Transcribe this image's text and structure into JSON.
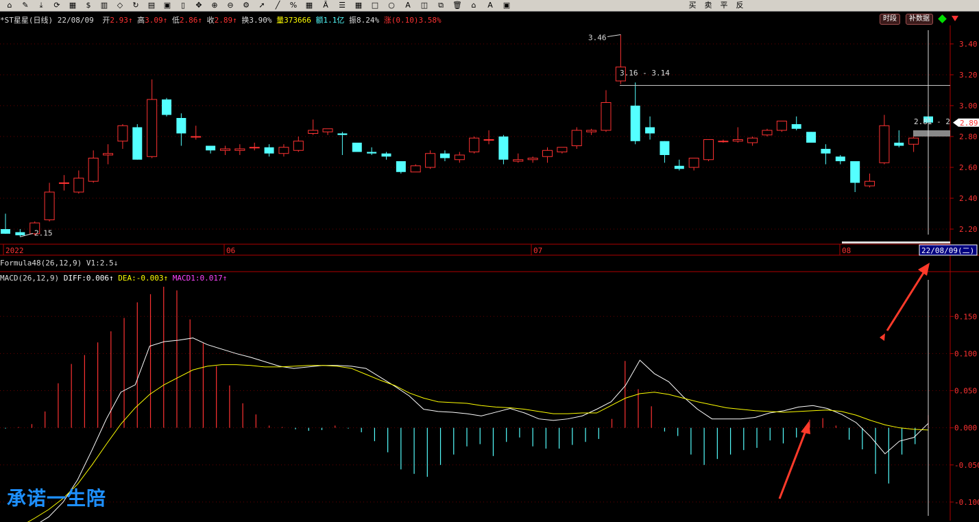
{
  "toolbar": {
    "icons": [
      "home-icon",
      "draw-icon",
      "download-icon",
      "sync-icon",
      "grid-icon",
      "dollar-icon",
      "bar-chart-icon",
      "diamond-icon",
      "refresh-icon",
      "doc-icon",
      "layout-icon",
      "book-icon",
      "move-icon",
      "zoom-in-icon",
      "zoom-out-icon",
      "settings-icon",
      "cursor-icon",
      "line-tool-icon",
      "percent-icon",
      "chart-type-icon",
      "text-tool-icon",
      "list-icon",
      "table-icon",
      "rect-tool-icon",
      "circle-tool-icon",
      "letter-a-icon",
      "shield-icon",
      "copy-icon",
      "trash-icon",
      "lock-icon",
      "font-color-icon",
      "save-icon"
    ],
    "text_buttons": [
      "买",
      "卖",
      "平",
      "反"
    ]
  },
  "header": {
    "title": "*ST星星(日线) 22/08/09",
    "open_label": "开",
    "open": "2.93",
    "high_label": "高",
    "high": "3.09",
    "low_label": "低",
    "low": "2.86",
    "close_label": "收",
    "close": "2.89",
    "turnover_label": "换",
    "turnover": "3.90%",
    "volume_label": "量",
    "volume": "373666",
    "amount_label": "额",
    "amount": "1.1亿",
    "amplitude_label": "振",
    "amplitude": "8.24%",
    "change_label": "涨",
    "change": "(0.10)3.58%",
    "btn_time": "时段",
    "btn_data": "补数据"
  },
  "formula_bar": {
    "text": "Formula48(26,12,9)  V1:2.5"
  },
  "macd_header": {
    "name": "MACD(26,12,9)",
    "diff_label": "DIFF:",
    "diff": "0.006",
    "dea_label": "DEA:",
    "dea": "-0.003",
    "macd_label": "MACD1:",
    "macd": "0.017"
  },
  "watermark": "承诺一生陪",
  "colors": {
    "up": "#ff3232",
    "down": "#54ffff",
    "axis": "#b00000",
    "diff": "#ffffff",
    "dea": "#ffff00",
    "bg": "#000000"
  },
  "chart_data": [
    {
      "type": "candlestick",
      "y_ticks": [
        "3.40",
        "3.20",
        "3.00",
        "2.80",
        "2.60",
        "2.40",
        "2.20"
      ],
      "ylim": [
        2.12,
        3.52
      ],
      "x_labels": [
        "2022",
        "06",
        "07",
        "08",
        "22/08/09(二)"
      ],
      "annotations": {
        "max_label": "3.46",
        "min_label": "2.15",
        "range_label": "3.16 - 3.14",
        "last_label": "2.81 - 2",
        "current_price": "2.89"
      },
      "candles": [
        [
          2.2,
          2.3,
          2.17,
          2.17
        ],
        [
          2.18,
          2.2,
          2.15,
          2.16
        ],
        [
          2.17,
          2.25,
          2.16,
          2.24
        ],
        [
          2.26,
          2.5,
          2.25,
          2.44
        ],
        [
          2.5,
          2.55,
          2.45,
          2.5
        ],
        [
          2.44,
          2.58,
          2.43,
          2.53
        ],
        [
          2.51,
          2.71,
          2.5,
          2.66
        ],
        [
          2.68,
          2.75,
          2.62,
          2.69
        ],
        [
          2.77,
          2.88,
          2.72,
          2.87
        ],
        [
          2.86,
          2.88,
          2.65,
          2.65
        ],
        [
          2.67,
          3.17,
          2.66,
          3.04
        ],
        [
          3.04,
          3.05,
          2.93,
          2.94
        ],
        [
          2.92,
          2.95,
          2.74,
          2.82
        ],
        [
          2.8,
          2.87,
          2.78,
          2.8
        ],
        [
          2.74,
          2.74,
          2.69,
          2.71
        ],
        [
          2.71,
          2.74,
          2.68,
          2.72
        ],
        [
          2.71,
          2.75,
          2.68,
          2.72
        ],
        [
          2.73,
          2.76,
          2.71,
          2.73
        ],
        [
          2.73,
          2.75,
          2.67,
          2.69
        ],
        [
          2.69,
          2.75,
          2.67,
          2.73
        ],
        [
          2.71,
          2.8,
          2.7,
          2.77
        ],
        [
          2.82,
          2.91,
          2.81,
          2.84
        ],
        [
          2.83,
          2.85,
          2.81,
          2.85
        ],
        [
          2.82,
          2.83,
          2.68,
          2.81
        ],
        [
          2.76,
          2.76,
          2.7,
          2.7
        ],
        [
          2.7,
          2.73,
          2.68,
          2.69
        ],
        [
          2.69,
          2.7,
          2.65,
          2.67
        ],
        [
          2.64,
          2.64,
          2.56,
          2.57
        ],
        [
          2.57,
          2.62,
          2.57,
          2.61
        ],
        [
          2.6,
          2.71,
          2.59,
          2.69
        ],
        [
          2.69,
          2.71,
          2.64,
          2.66
        ],
        [
          2.65,
          2.7,
          2.63,
          2.68
        ],
        [
          2.7,
          2.8,
          2.69,
          2.79
        ],
        [
          2.78,
          2.84,
          2.75,
          2.78
        ],
        [
          2.8,
          2.81,
          2.62,
          2.65
        ],
        [
          2.64,
          2.69,
          2.63,
          2.65
        ],
        [
          2.65,
          2.67,
          2.63,
          2.66
        ],
        [
          2.67,
          2.73,
          2.63,
          2.71
        ],
        [
          2.7,
          2.73,
          2.69,
          2.73
        ],
        [
          2.74,
          2.86,
          2.72,
          2.84
        ],
        [
          2.83,
          2.85,
          2.81,
          2.84
        ],
        [
          2.84,
          3.1,
          2.83,
          3.02
        ],
        [
          3.16,
          3.46,
          3.14,
          3.25
        ],
        [
          3.0,
          3.15,
          2.75,
          2.77
        ],
        [
          2.86,
          2.93,
          2.78,
          2.82
        ],
        [
          2.77,
          2.77,
          2.63,
          2.68
        ],
        [
          2.61,
          2.65,
          2.58,
          2.59
        ],
        [
          2.6,
          2.66,
          2.58,
          2.66
        ],
        [
          2.65,
          2.78,
          2.64,
          2.78
        ],
        [
          2.77,
          2.78,
          2.76,
          2.77
        ],
        [
          2.77,
          2.86,
          2.76,
          2.78
        ],
        [
          2.76,
          2.8,
          2.74,
          2.79
        ],
        [
          2.81,
          2.85,
          2.8,
          2.84
        ],
        [
          2.84,
          2.9,
          2.83,
          2.9
        ],
        [
          2.88,
          2.93,
          2.84,
          2.85
        ],
        [
          2.83,
          2.83,
          2.76,
          2.76
        ],
        [
          2.72,
          2.75,
          2.62,
          2.69
        ],
        [
          2.67,
          2.68,
          2.62,
          2.64
        ],
        [
          2.64,
          2.64,
          2.44,
          2.5
        ],
        [
          2.48,
          2.56,
          2.47,
          2.51
        ],
        [
          2.63,
          2.94,
          2.62,
          2.87
        ],
        [
          2.76,
          2.84,
          2.73,
          2.74
        ],
        [
          2.75,
          2.81,
          2.7,
          2.79
        ],
        [
          2.93,
          3.09,
          2.86,
          2.89
        ]
      ]
    },
    {
      "type": "macd",
      "y_ticks": [
        "0.150",
        "0.100",
        "0.050",
        "0.000",
        "-0.050",
        "-0.100"
      ],
      "ylim": [
        -0.125,
        0.19
      ],
      "diff": [
        -0.14,
        -0.138,
        -0.132,
        -0.12,
        -0.1,
        -0.07,
        -0.03,
        0.012,
        0.048,
        0.058,
        0.11,
        0.116,
        0.118,
        0.121,
        0.112,
        0.106,
        0.1,
        0.095,
        0.089,
        0.083,
        0.08,
        0.082,
        0.084,
        0.084,
        0.083,
        0.08,
        0.068,
        0.056,
        0.043,
        0.025,
        0.022,
        0.021,
        0.019,
        0.016,
        0.021,
        0.026,
        0.02,
        0.012,
        0.01,
        0.012,
        0.016,
        0.025,
        0.035,
        0.057,
        0.091,
        0.073,
        0.062,
        0.042,
        0.025,
        0.012,
        0.012,
        0.012,
        0.014,
        0.02,
        0.023,
        0.028,
        0.03,
        0.026,
        0.018,
        0.007,
        -0.012,
        -0.035,
        -0.018,
        -0.013,
        0.006
      ],
      "dea": [
        -0.14,
        -0.133,
        -0.122,
        -0.11,
        -0.095,
        -0.076,
        -0.05,
        -0.022,
        0.005,
        0.027,
        0.045,
        0.058,
        0.068,
        0.078,
        0.083,
        0.085,
        0.085,
        0.084,
        0.082,
        0.082,
        0.083,
        0.084,
        0.084,
        0.083,
        0.08,
        0.072,
        0.064,
        0.057,
        0.047,
        0.04,
        0.035,
        0.034,
        0.033,
        0.03,
        0.028,
        0.027,
        0.025,
        0.022,
        0.019,
        0.019,
        0.02,
        0.02,
        0.03,
        0.04,
        0.046,
        0.048,
        0.045,
        0.04,
        0.035,
        0.031,
        0.027,
        0.025,
        0.023,
        0.022,
        0.021,
        0.022,
        0.023,
        0.024,
        0.022,
        0.017,
        0.01,
        0.004,
        0.0,
        -0.002,
        -0.003
      ],
      "bars": [
        -0.001,
        0.001,
        0.005,
        0.022,
        0.06,
        0.086,
        0.098,
        0.115,
        0.13,
        0.148,
        0.169,
        0.18,
        0.19,
        0.185,
        0.146,
        0.114,
        0.083,
        0.057,
        0.033,
        0.018,
        0.003,
        0.001,
        -0.002,
        -0.004,
        -0.003,
        0.003,
        -0.001,
        -0.006,
        -0.018,
        -0.033,
        -0.056,
        -0.062,
        -0.066,
        -0.05,
        -0.036,
        -0.025,
        -0.022,
        -0.038,
        -0.019,
        -0.013,
        -0.025,
        -0.028,
        -0.028,
        -0.023,
        -0.019,
        -0.015,
        0.012,
        0.09,
        0.052,
        0.029,
        -0.005,
        -0.011,
        -0.036,
        -0.05,
        -0.042,
        -0.036,
        -0.03,
        -0.027,
        -0.017,
        -0.021,
        -0.013,
        0.011,
        0.013,
        0.003,
        -0.016,
        -0.029,
        -0.062,
        -0.075,
        -0.036,
        -0.022,
        0.017
      ]
    }
  ]
}
